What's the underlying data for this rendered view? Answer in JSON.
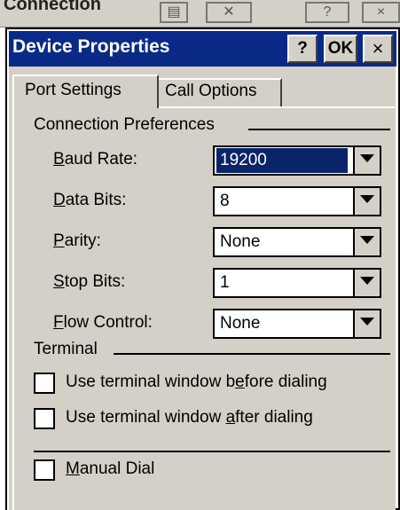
{
  "background_window": {
    "title": "Connection"
  },
  "dialog": {
    "title": "Device Properties",
    "help_label": "?",
    "ok_label": "OK",
    "close_label": "×"
  },
  "tabs": [
    {
      "label": "Port Settings",
      "active": true
    },
    {
      "label": "Call Options",
      "active": false
    }
  ],
  "connection_preferences": {
    "heading": "Connection Preferences",
    "fields": [
      {
        "label_pre": "",
        "label_mnemonic": "B",
        "label_post": "aud Rate:",
        "value": "19200",
        "selected": true
      },
      {
        "label_pre": "",
        "label_mnemonic": "D",
        "label_post": "ata Bits:",
        "value": "8",
        "selected": false
      },
      {
        "label_pre": "",
        "label_mnemonic": "P",
        "label_post": "arity:",
        "value": "None",
        "selected": false
      },
      {
        "label_pre": "",
        "label_mnemonic": "S",
        "label_post": "top Bits:",
        "value": "1",
        "selected": false
      },
      {
        "label_pre": "",
        "label_mnemonic": "F",
        "label_post": "low Control:",
        "value": "None",
        "selected": false
      }
    ]
  },
  "terminal": {
    "heading": "Terminal",
    "options": [
      {
        "label_pre": "Use terminal window b",
        "label_mnemonic": "e",
        "label_post": "fore dialing",
        "checked": false
      },
      {
        "label_pre": "Use terminal window ",
        "label_mnemonic": "a",
        "label_post": "fter dialing",
        "checked": false
      }
    ]
  },
  "manual_dial": {
    "label_pre": "",
    "label_mnemonic": "M",
    "label_post": "anual Dial",
    "checked": false
  },
  "colors": {
    "titlebar": "#0a2a8c",
    "face": "#d4d0c8",
    "selection": "#0a246a"
  }
}
